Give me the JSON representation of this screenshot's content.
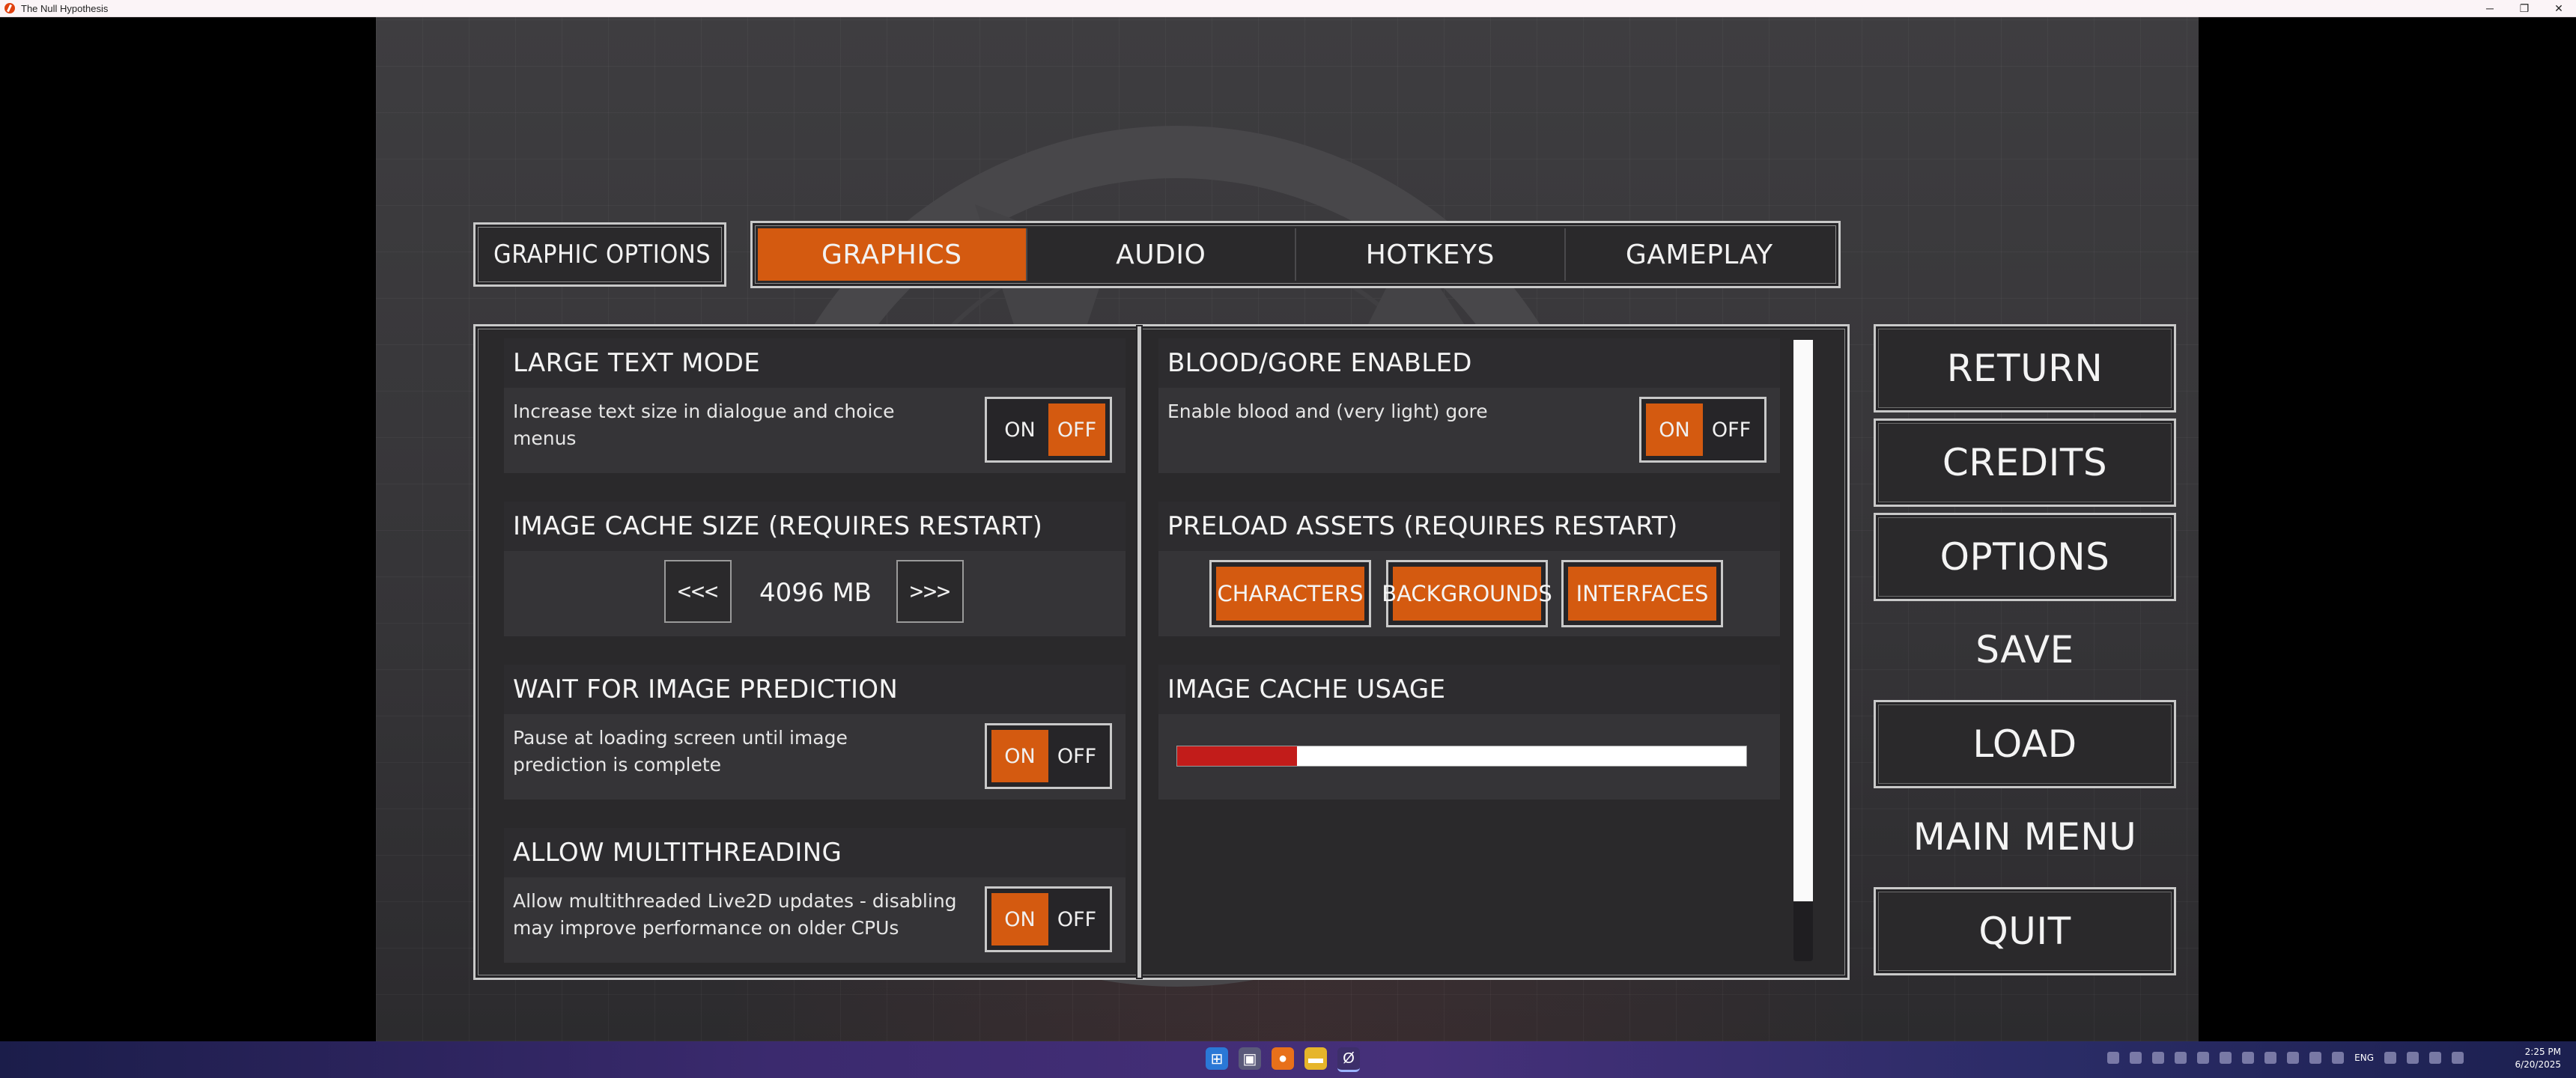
{
  "window": {
    "title": "The Null Hypothesis",
    "controls": {
      "minimize": "─",
      "maximize": "❐",
      "close": "✕"
    }
  },
  "header": {
    "label": "GRAPHIC OPTIONS",
    "tabs": [
      {
        "label": "GRAPHICS",
        "active": true
      },
      {
        "label": "AUDIO",
        "active": false
      },
      {
        "label": "HOTKEYS",
        "active": false
      },
      {
        "label": "GAMEPLAY",
        "active": false
      }
    ]
  },
  "left_settings": {
    "large_text": {
      "title": "LARGE TEXT MODE",
      "description": "Increase text size in dialogue and choice menus",
      "on_label": "ON",
      "off_label": "OFF",
      "value": "OFF"
    },
    "image_cache": {
      "title": "IMAGE CACHE SIZE (REQUIRES RESTART)",
      "decrease_label": "<<<",
      "value": "4096 MB",
      "increase_label": ">>>"
    },
    "wait_prediction": {
      "title": "WAIT FOR IMAGE PREDICTION",
      "description": "Pause at loading screen until image prediction is complete",
      "on_label": "ON",
      "off_label": "OFF",
      "value": "ON"
    },
    "multithreading": {
      "title": "ALLOW MULTITHREADING",
      "description": "Allow multithreaded Live2D updates - disabling may improve performance on older CPUs",
      "on_label": "ON",
      "off_label": "OFF",
      "value": "ON"
    }
  },
  "right_settings": {
    "blood_gore": {
      "title": "BLOOD/GORE ENABLED",
      "description": "Enable blood and (very light) gore",
      "on_label": "ON",
      "off_label": "OFF",
      "value": "ON"
    },
    "preload_assets": {
      "title": "PRELOAD ASSETS (REQUIRES RESTART)",
      "characters_label": "CHARACTERS",
      "backgrounds_label": "BACKGROUNDS",
      "interfaces_label": "INTERFACES"
    },
    "cache_usage": {
      "title": "IMAGE CACHE USAGE",
      "fraction": 0.21
    }
  },
  "side_menu": {
    "return": "RETURN",
    "credits": "CREDITS",
    "options": "OPTIONS",
    "save": "SAVE",
    "load": "LOAD",
    "main_menu": "MAIN MENU",
    "quit": "QUIT"
  },
  "taskbar": {
    "language": "ENG",
    "time": "2:25 PM",
    "date": "6/20/2025"
  },
  "colors": {
    "accent": "#d45a10",
    "usage_fill": "#c21c1a",
    "panel_bg": "#2a292b"
  }
}
